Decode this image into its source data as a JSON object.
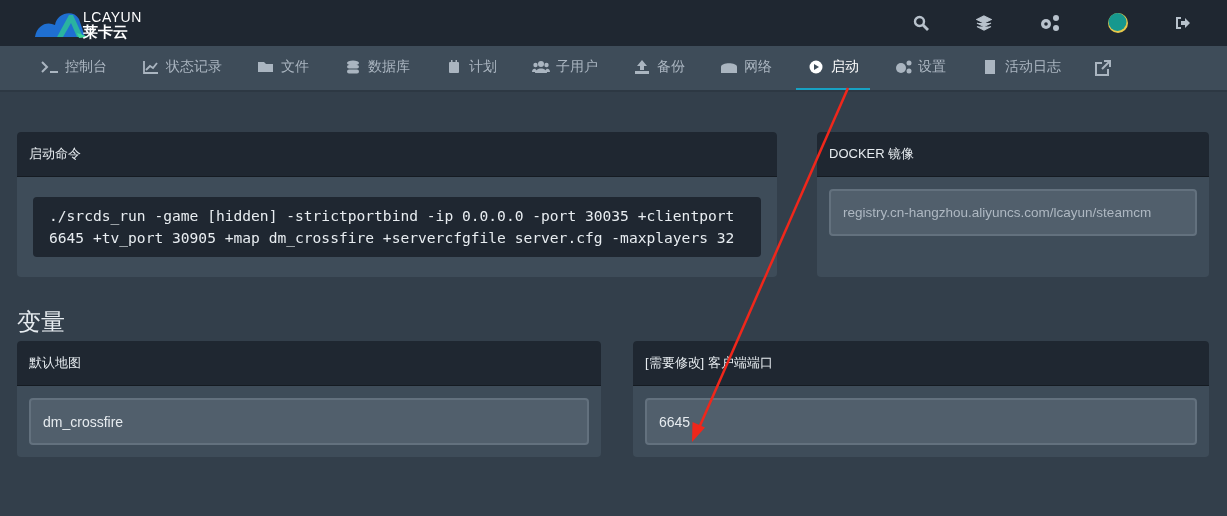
{
  "logo": {
    "brand": "LCAYUN",
    "name": "莱卡云"
  },
  "tabs": [
    {
      "label": "控制台",
      "selected": false
    },
    {
      "label": "状态记录",
      "selected": false
    },
    {
      "label": "文件",
      "selected": false
    },
    {
      "label": "数据库",
      "selected": false
    },
    {
      "label": "计划",
      "selected": false
    },
    {
      "label": "子用户",
      "selected": false
    },
    {
      "label": "备份",
      "selected": false
    },
    {
      "label": "网络",
      "selected": false
    },
    {
      "label": "启动",
      "selected": true
    },
    {
      "label": "设置",
      "selected": false
    },
    {
      "label": "活动日志",
      "selected": false
    }
  ],
  "startup": {
    "title": "启动命令",
    "command": "./srcds_run -game [hidden] -strictportbind -ip 0.0.0.0 -port 30035 +clientport 6645 +tv_port 30905 +map dm_crossfire +servercfgfile server.cfg -maxplayers 32"
  },
  "docker": {
    "title": "DOCKER 镜像",
    "value": "registry.cn-hangzhou.aliyuncs.com/lcayun/steamcm"
  },
  "variables_heading": "变量",
  "variables": [
    {
      "label": "默认地图",
      "value": "dm_crossfire"
    },
    {
      "label": "[需要修改] 客户端端口",
      "value": "6645"
    }
  ]
}
